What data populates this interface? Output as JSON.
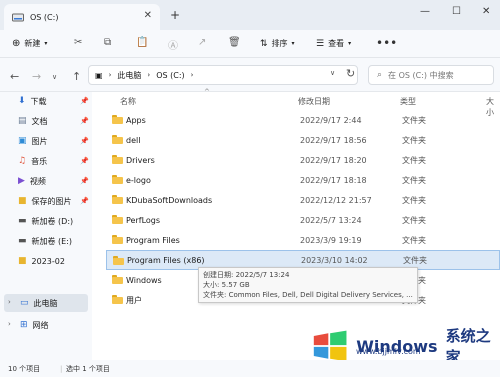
{
  "tab": {
    "title": "OS (C:)"
  },
  "commands": {
    "new": "新建",
    "sort": "排序",
    "view": "查看"
  },
  "address": {
    "segments": [
      "此电脑",
      "OS (C:)"
    ],
    "search_placeholder": "在 OS (C:) 中搜索"
  },
  "sidebar": {
    "items": [
      {
        "label": "下载",
        "icon": "download-icon"
      },
      {
        "label": "文档",
        "icon": "document-icon"
      },
      {
        "label": "图片",
        "icon": "picture-icon"
      },
      {
        "label": "音乐",
        "icon": "music-icon"
      },
      {
        "label": "视频",
        "icon": "video-icon"
      },
      {
        "label": "保存的图片",
        "icon": "folder-icon"
      },
      {
        "label": "新加卷 (D:)",
        "icon": "drive-icon"
      },
      {
        "label": "新加卷 (E:)",
        "icon": "drive-icon"
      },
      {
        "label": "2023-02",
        "icon": "folder-icon"
      },
      {
        "label": "此电脑",
        "icon": "computer-icon"
      },
      {
        "label": "网络",
        "icon": "network-icon"
      }
    ]
  },
  "columns": {
    "name": "名称",
    "date": "修改日期",
    "type": "类型",
    "size": "大小"
  },
  "files": [
    {
      "name": "Apps",
      "date": "2022/9/17 2:44",
      "type": "文件夹"
    },
    {
      "name": "dell",
      "date": "2022/9/17 18:56",
      "type": "文件夹"
    },
    {
      "name": "Drivers",
      "date": "2022/9/17 18:20",
      "type": "文件夹"
    },
    {
      "name": "e-logo",
      "date": "2022/9/17 18:18",
      "type": "文件夹"
    },
    {
      "name": "KDubaSoftDownloads",
      "date": "2022/12/12 21:57",
      "type": "文件夹"
    },
    {
      "name": "PerfLogs",
      "date": "2022/5/7 13:24",
      "type": "文件夹"
    },
    {
      "name": "Program Files",
      "date": "2023/3/9 19:19",
      "type": "文件夹"
    },
    {
      "name": "Program Files (x86)",
      "date": "2023/3/10 14:02",
      "type": "文件夹"
    },
    {
      "name": "Windows",
      "date": "",
      "type": "文件夹"
    },
    {
      "name": "用户",
      "date": "",
      "type": "文件夹"
    }
  ],
  "tooltip": {
    "line1": "创建日期: 2022/5/7 13:24",
    "line2": "大小: 5.57 GB",
    "line3": "文件夹: Common Files, Dell, Dell Digital Delivery Services, ..."
  },
  "status": {
    "count": "10 个项目",
    "selected": "选中 1 个项目"
  },
  "watermark": {
    "brand": "Windows",
    "cn": "系统之家",
    "url": "www.bjjmlv.com"
  }
}
